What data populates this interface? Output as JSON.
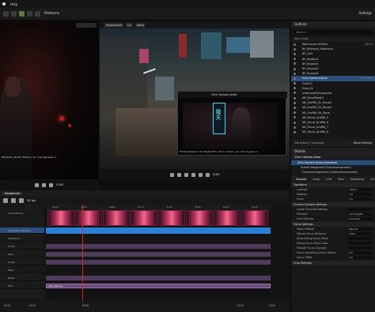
{
  "menu": {
    "items": [
      "Help"
    ]
  },
  "toolbar": {
    "platforms": "Platforms",
    "settings": "Settings"
  },
  "viewport_main": {
    "perspective": "Perspective",
    "lit": "Lit",
    "show": "Show",
    "pip_label": "Cine Camera Actor",
    "pip_sign": "隆夫",
    "pip_info": "Filmback|Preset: 16:9 Digital Film | Zoom: 50mm | Av: 2.8 | Squeeze: 1",
    "frame": "0184"
  },
  "viewport_left": {
    "info": "Filmback | Zoom: 50mm | Av: 2.8 | Squeeze: 1",
    "frame": "0184"
  },
  "outliner": {
    "title": "Outliner",
    "search_placeholder": "Search...",
    "header": "Item Label",
    "rows": [
      {
        "label": "Warehouse (Editor)",
        "type": "World"
      },
      {
        "label": "BP_Billboard_Positionin",
        "type": ""
      },
      {
        "label": "BP_Cart",
        "type": ""
      },
      {
        "label": "BP_Keybox3",
        "type": ""
      },
      {
        "label": "BP_Keybox4",
        "type": ""
      },
      {
        "label": "BP_Keybox5",
        "type": ""
      },
      {
        "label": "BP_Keybox6",
        "type": ""
      },
      {
        "label": "Cine Camera Actor",
        "type": "CineCam",
        "selected": true
      },
      {
        "label": "Cube11",
        "type": ""
      },
      {
        "label": "Decal_B",
        "type": ""
      },
      {
        "label": "InstancedFoliageActor",
        "type": ""
      },
      {
        "label": "NE_DecalMadk1",
        "type": ""
      },
      {
        "label": "NE_Graffiti_01_Decal2",
        "type": ""
      },
      {
        "label": "NE_Graffiti_03_Decal3",
        "type": ""
      },
      {
        "label": "NE_Graffiti_04_Decal",
        "type": ""
      },
      {
        "label": "NE_Decal_Graffiti_5",
        "type": ""
      },
      {
        "label": "NE_Decal_Graffiti_6",
        "type": ""
      },
      {
        "label": "NE_Decal_Graffiti_7",
        "type": ""
      },
      {
        "label": "NE_Decal_Graffiti_8",
        "type": ""
      }
    ],
    "footer": "546 actors (1 selected)",
    "world_settings": "World Settings"
  },
  "details": {
    "title": "Details",
    "actor": "Cine Camera Actor",
    "components": [
      "Cine Camera Actor (Instance)",
      "SceneComponent (SceneComponent)",
      "CameraComponent (CameraComponent)"
    ],
    "tabs": [
      "General",
      "Actor",
      "LOD",
      "Misc",
      "Streaming",
      "All"
    ],
    "sections": [
      {
        "name": "Transform",
        "props": [
          {
            "k": "Location",
            "v": "-400.0"
          },
          {
            "k": "Rotation",
            "v": "0.0"
          },
          {
            "k": "Scale",
            "v": "1.0"
          }
        ]
      },
      {
        "name": "Current Camera Settings",
        "props": [
          {
            "k": "Lookat Tracking Settings",
            "v": ""
          },
          {
            "k": "Filmback",
            "v": "16:9 Digital"
          },
          {
            "k": "Lens Settings",
            "v": "Universal"
          }
        ]
      },
      {
        "name": "Focus Settings",
        "props": [
          {
            "k": "Focus Method",
            "v": "Manual"
          },
          {
            "k": "Manual Focus Distance",
            "v": "1000"
          },
          {
            "k": "Draw Debug Focus Plane",
            "v": ""
          },
          {
            "k": "Debug Focus Plane Color",
            "v": ""
          },
          {
            "k": "Smooth Focus Changes",
            "v": ""
          },
          {
            "k": "Focus Smoothing Interp Speed",
            "v": "8.0"
          },
          {
            "k": "Focus Offset",
            "v": "0.0"
          }
        ]
      },
      {
        "name": "Crop Settings",
        "props": []
      }
    ]
  },
  "sequencer": {
    "tabs": [
      "Sequencer"
    ],
    "fps": "30 fps",
    "ruler": [
      "0030",
      "0060",
      "0090",
      "0120",
      "0150",
      "0180",
      "0210",
      "0240"
    ],
    "tracks": [
      {
        "label": "Cine Camera",
        "selected": false
      },
      {
        "label": "CameraComponent",
        "selected": true
      },
      {
        "label": "Transform",
        "selected": false
      },
      {
        "label": "Focus",
        "selected": false
      },
      {
        "label": "Shot",
        "selected": false
      },
      {
        "label": "Audio",
        "selected": false
      },
      {
        "label": "Fade",
        "selected": false
      },
      {
        "label": "Event",
        "selected": false
      },
      {
        "label": "Sub",
        "selected": false
      }
    ],
    "clip_label": "nNe_Reboot",
    "bottom_frames": [
      "-0015",
      "-0015",
      "0030",
      "0240",
      "0240"
    ]
  },
  "colors": {
    "accent": "#2b7fd4",
    "selection": "#2b4f7a",
    "purple": "#7a4a8a",
    "playhead": "#cc2a2a"
  }
}
